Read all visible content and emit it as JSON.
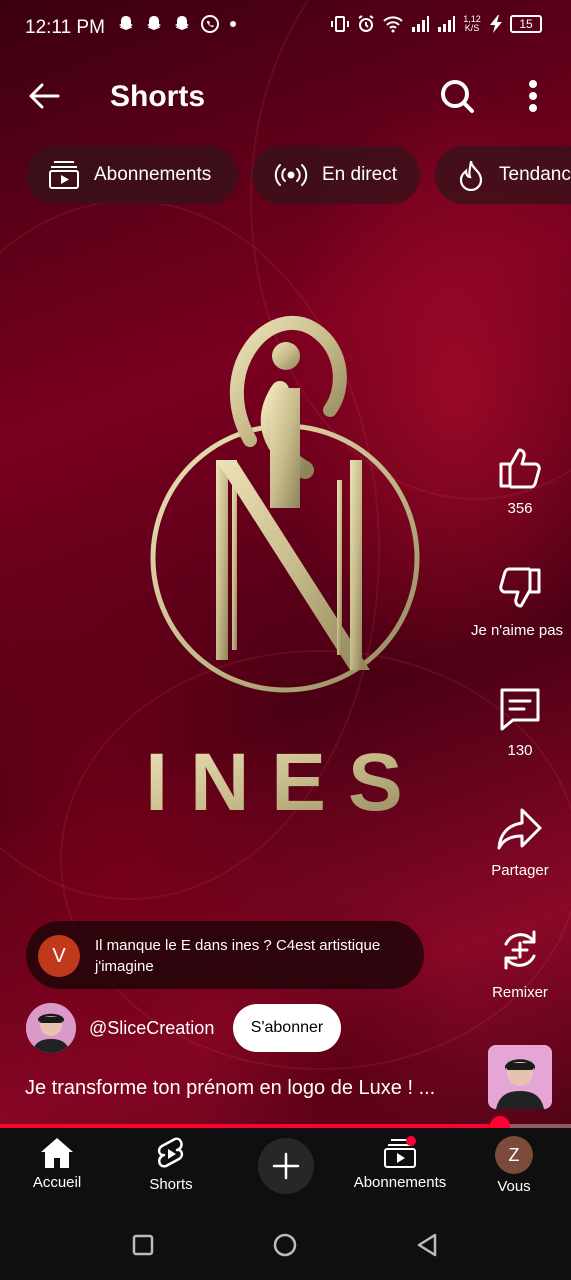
{
  "status_bar": {
    "time": "12:11 PM",
    "network_speed": "1,12",
    "network_unit": "K/S",
    "battery": "15"
  },
  "header": {
    "title": "Shorts"
  },
  "chips": [
    {
      "label": "Abonnements",
      "icon": "subscriptions-icon"
    },
    {
      "label": "En direct",
      "icon": "live-icon"
    },
    {
      "label": "Tendances",
      "icon": "trending-icon"
    }
  ],
  "video": {
    "logo_text": "INES",
    "title": "Je transforme ton prénom en logo de Luxe ! ...",
    "progress_percent": 87.5
  },
  "actions": {
    "like_count": "356",
    "dislike_label": "Je n'aime pas",
    "comment_count": "130",
    "share_label": "Partager",
    "remix_label": "Remixer"
  },
  "comment": {
    "avatar_letter": "V",
    "text": "Il manque le E dans ines ? C4est artistique j'imagine"
  },
  "channel": {
    "name": "@SliceCreation",
    "subscribe_label": "S'abonner"
  },
  "bottom_nav": {
    "home": "Accueil",
    "shorts": "Shorts",
    "subscriptions": "Abonnements",
    "you": "Vous",
    "you_avatar_letter": "Z"
  },
  "colors": {
    "accent": "#ff0033",
    "gold": "#c8bc8c",
    "background": "#7a0020"
  }
}
